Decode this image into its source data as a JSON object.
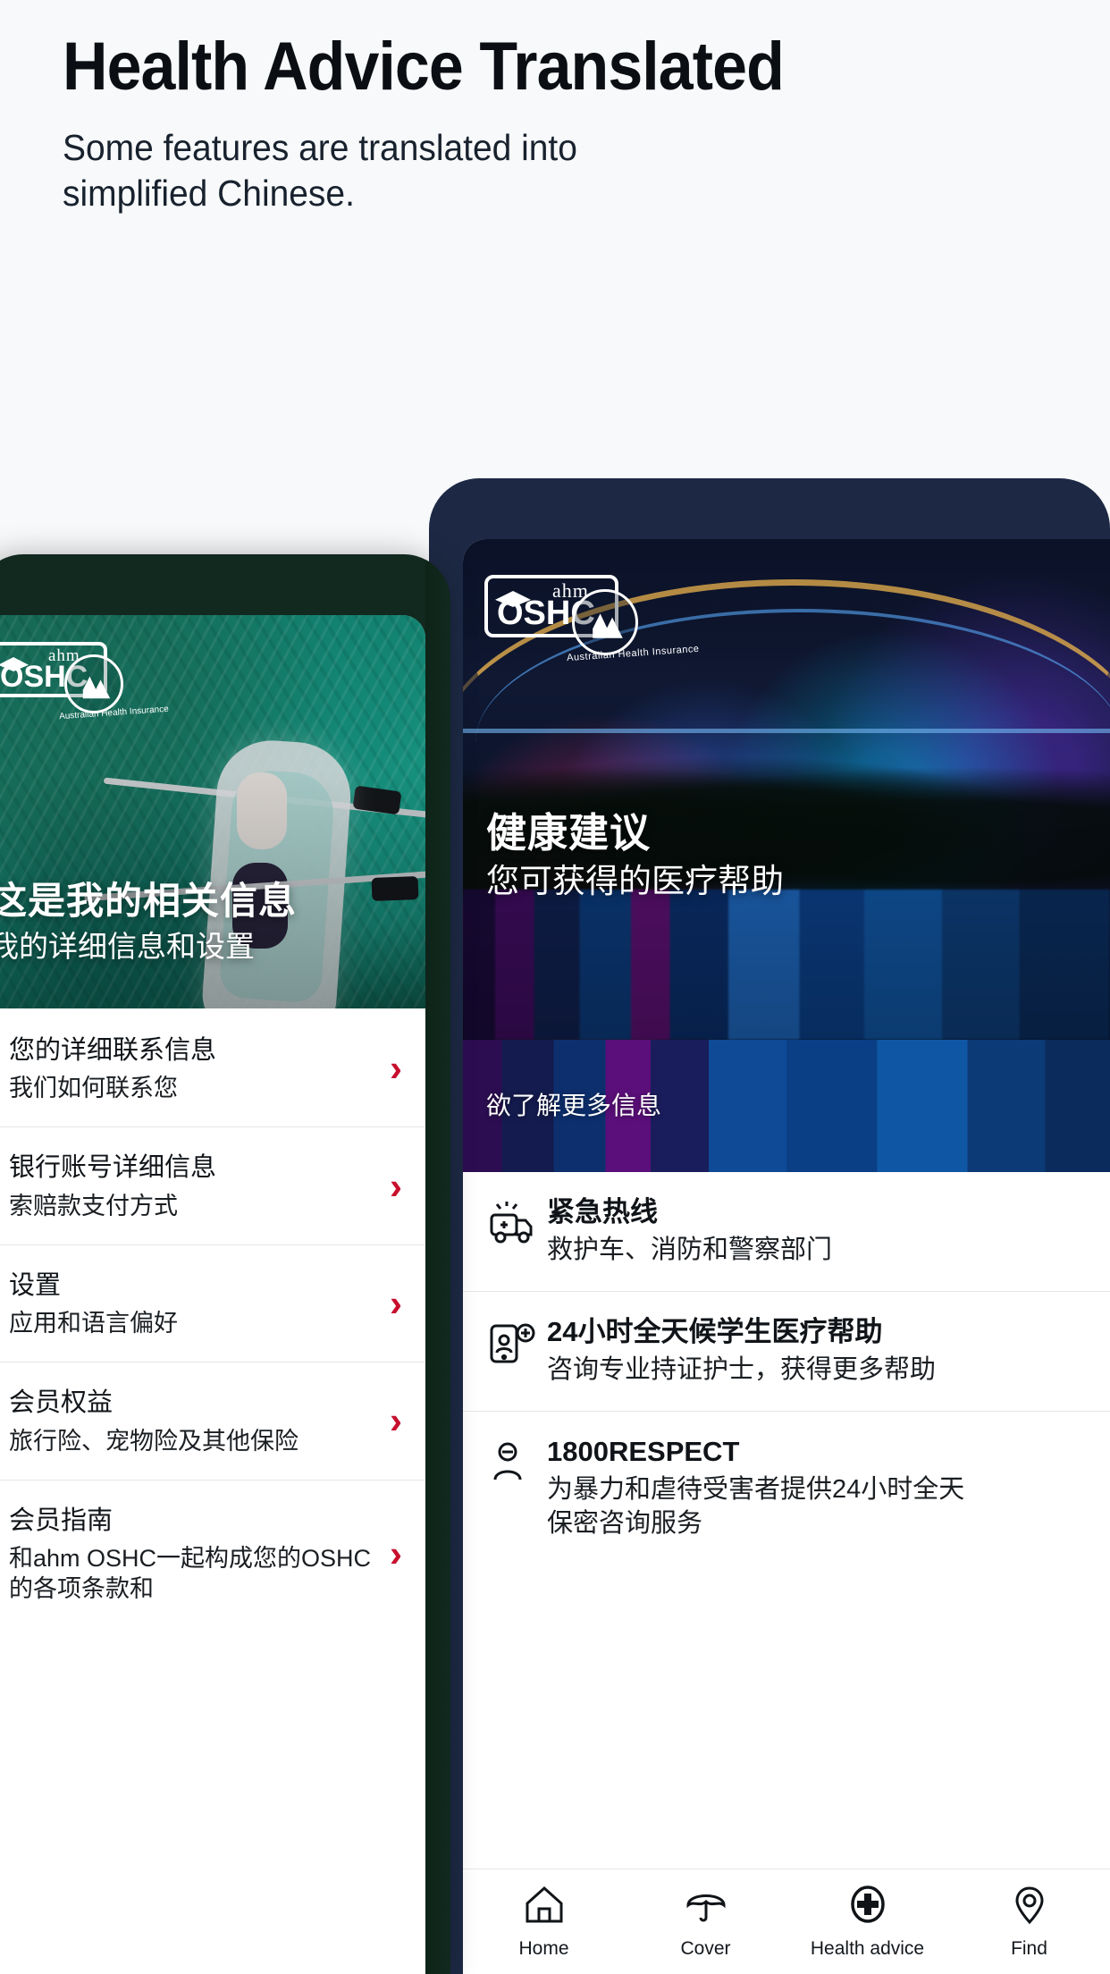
{
  "header": {
    "headline": "Health Advice Translated",
    "subtitle_line1": "Some features are translated into",
    "subtitle_line2": "simplified Chinese."
  },
  "colors": {
    "page_background": "#f7f9fa",
    "headline": "#0b0f14",
    "chevron_accent": "#c8102e",
    "left_phone_frame": "#11291f",
    "right_phone_frame": "#1d2944"
  },
  "left_phone": {
    "logo": {
      "brand": "ahm",
      "product": "OSHC",
      "roundel_text": "Australian Health Insurance"
    },
    "hero": {
      "title": "这是我的相关信息",
      "subtitle": "我的详细信息和设置"
    },
    "rows": [
      {
        "title": "您的详细联系信息",
        "desc": "我们如何联系您",
        "chevron": "›"
      },
      {
        "title": "银行账号详细信息",
        "desc": "索赔款支付方式",
        "chevron": "›"
      },
      {
        "title": "设置",
        "desc": "应用和语言偏好",
        "chevron": "›"
      },
      {
        "title": "会员权益",
        "desc": "旅行险、宠物险及其他保险",
        "chevron": "›"
      },
      {
        "title": "会员指南",
        "desc": "和ahm OSHC一起构成您的OSHC的各项条款和",
        "chevron": "›"
      }
    ]
  },
  "right_phone": {
    "logo": {
      "brand": "ahm",
      "product": "OSHC",
      "roundel_text": "Australian Health Insurance"
    },
    "hero": {
      "title": "健康建议",
      "subtitle": "您可获得的医疗帮助"
    },
    "band": {
      "label": "欲了解更多信息"
    },
    "rows": [
      {
        "icon": "ambulance-icon",
        "title": "紧急热线",
        "desc": "救护车、消防和警察部门"
      },
      {
        "icon": "nurse-phone-icon",
        "title": "24小时全天候学生医疗帮助",
        "desc": "咨询专业持证护士，获得更多帮助"
      },
      {
        "icon": "person-support-icon",
        "title": "1800RESPECT",
        "desc": "为暴力和虐待受害者提供24小时全天\n保密咨询服务"
      }
    ],
    "nav": [
      {
        "icon": "home-icon",
        "label": "Home"
      },
      {
        "icon": "umbrella-icon",
        "label": "Cover"
      },
      {
        "icon": "medical-cross-icon",
        "label": "Health advice"
      },
      {
        "icon": "location-pin-icon",
        "label": "Find"
      }
    ]
  }
}
